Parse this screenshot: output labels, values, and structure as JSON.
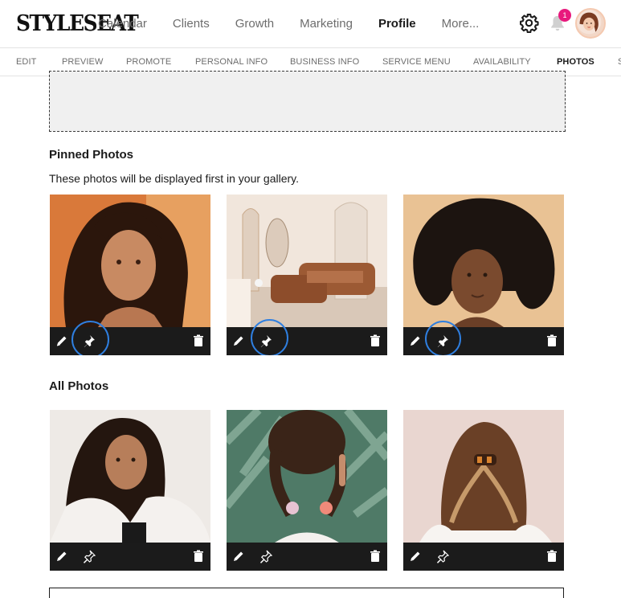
{
  "brand": {
    "logo_text": "STYLESEAT"
  },
  "nav": {
    "items": [
      {
        "label": "Calendar",
        "active": false
      },
      {
        "label": "Clients",
        "active": false
      },
      {
        "label": "Growth",
        "active": false
      },
      {
        "label": "Marketing",
        "active": false
      },
      {
        "label": "Profile",
        "active": true
      },
      {
        "label": "More...",
        "active": false
      }
    ],
    "notification_count": "1"
  },
  "subnav": {
    "items": [
      {
        "label": "EDIT",
        "active": false
      },
      {
        "label": "PREVIEW",
        "active": false
      },
      {
        "label": "PROMOTE",
        "active": false
      },
      {
        "label": "PERSONAL INFO",
        "active": false
      },
      {
        "label": "BUSINESS INFO",
        "active": false
      },
      {
        "label": "SERVICE MENU",
        "active": false
      },
      {
        "label": "AVAILABILITY",
        "active": false
      },
      {
        "label": "PHOTOS",
        "active": true
      },
      {
        "label": "S",
        "active": false
      }
    ]
  },
  "pinned": {
    "title": "Pinned Photos",
    "description": "These photos will be displayed first in your gallery.",
    "photos": [
      {
        "subject": "woman with curly hair, orange background",
        "pinned": true
      },
      {
        "subject": "salon interior with brown chairs and mirrors",
        "pinned": true
      },
      {
        "subject": "woman with afro hair, peach background",
        "pinned": true
      }
    ]
  },
  "all": {
    "title": "All Photos",
    "photos": [
      {
        "subject": "woman with long dark hair in white top",
        "pinned": false
      },
      {
        "subject": "braided pigtails with scrunchies, plants background",
        "pinned": false
      },
      {
        "subject": "half-up hairstyle with tortoise clip",
        "pinned": false
      }
    ]
  },
  "colors": {
    "accent_ring": "#2f7fe0",
    "badge": "#e8197d",
    "toolbar": "#1b1b1b"
  },
  "icons": [
    "settings-gear-icon",
    "bell-icon",
    "edit-pencil-icon",
    "pin-icon",
    "trash-icon"
  ]
}
